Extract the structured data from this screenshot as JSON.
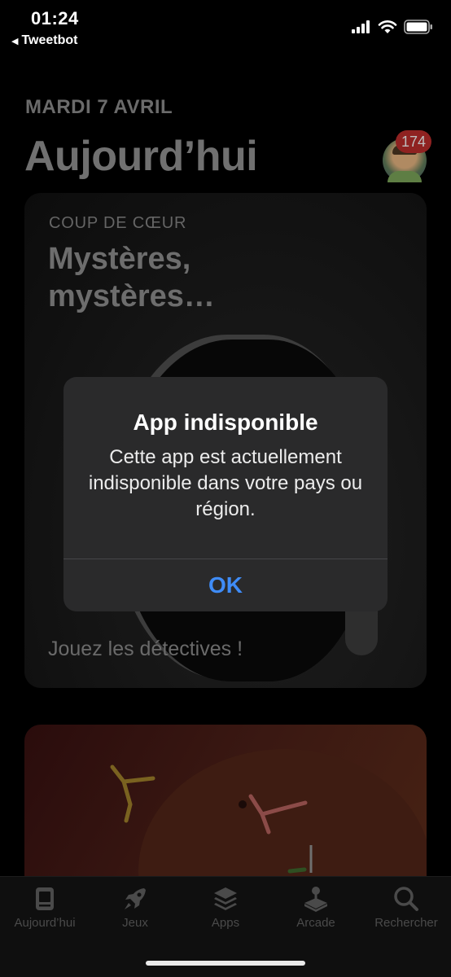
{
  "status_bar": {
    "time": "01:24",
    "back_app": "Tweetbot",
    "icons": [
      "cellular-signal-icon",
      "wifi-icon",
      "battery-icon"
    ]
  },
  "header": {
    "date": "MARDI 7 AVRIL",
    "title": "Aujourd’hui",
    "account_badge": "174"
  },
  "featured_card": {
    "eyebrow": "COUP DE CŒUR",
    "headline": "Mystères, mystères…",
    "subtitle": "Jouez les détectives !"
  },
  "alert": {
    "title": "App indisponible",
    "message": "Cette app est actuellement indisponible dans votre pays ou région.",
    "ok_label": "OK"
  },
  "tab_bar": {
    "tabs": [
      {
        "label": "Aujourd’hui",
        "icon": "today-icon"
      },
      {
        "label": "Jeux",
        "icon": "rocket-icon"
      },
      {
        "label": "Apps",
        "icon": "layers-icon"
      },
      {
        "label": "Arcade",
        "icon": "joystick-icon"
      },
      {
        "label": "Rechercher",
        "icon": "search-icon"
      }
    ]
  },
  "colors": {
    "accent": "#3f8cf7",
    "badge": "#8f2221",
    "alert_background": "#2a2a2b"
  }
}
